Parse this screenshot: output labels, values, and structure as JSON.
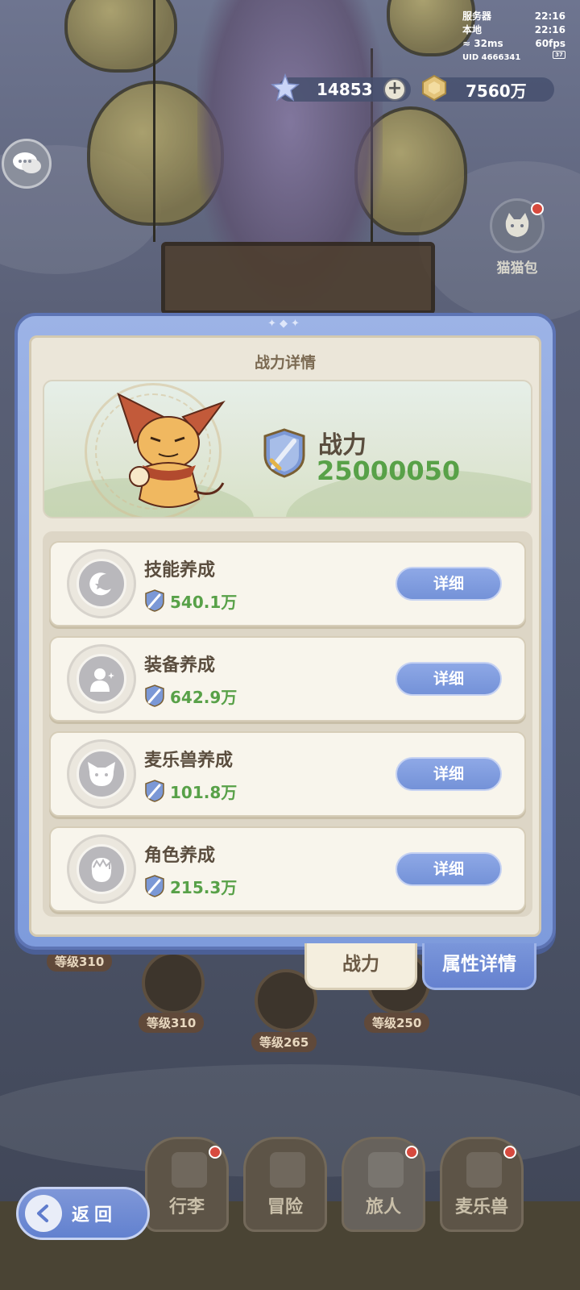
{
  "status": {
    "server_label": "服务器",
    "server_time": "22:16",
    "local_label": "本地",
    "local_time": "22:16",
    "ping": "32ms",
    "fps": "60fps",
    "uid": "UID 4666341",
    "battery": "37"
  },
  "currency": {
    "stars": "14853",
    "gold": "7560万"
  },
  "side": {
    "cat_bag_label": "猫猫包"
  },
  "dialog": {
    "title": "战力详情",
    "power_label": "战力",
    "power_value": "25000050",
    "items": [
      {
        "title": "技能养成",
        "value": "540.1万",
        "button": "详细",
        "icon": "moon-star-icon"
      },
      {
        "title": "装备养成",
        "value": "642.9万",
        "button": "详细",
        "icon": "person-sparkle-icon"
      },
      {
        "title": "麦乐兽养成",
        "value": "101.8万",
        "button": "详细",
        "icon": "cat-face-icon"
      },
      {
        "title": "角色养成",
        "value": "215.3万",
        "button": "详细",
        "icon": "character-head-icon"
      }
    ],
    "tabs": {
      "power": "战力",
      "attributes": "属性详情"
    }
  },
  "background": {
    "levels": [
      "等级310",
      "等级310",
      "等级265",
      "等级250"
    ]
  },
  "nav": {
    "back": "返回",
    "tabs": [
      "行李",
      "冒险",
      "旅人",
      "麦乐兽"
    ]
  },
  "colors": {
    "accent_blue": "#7492d8",
    "value_green": "#58a148",
    "panel_bg": "#ebe6d9",
    "text_brown": "#5a4d3e"
  }
}
